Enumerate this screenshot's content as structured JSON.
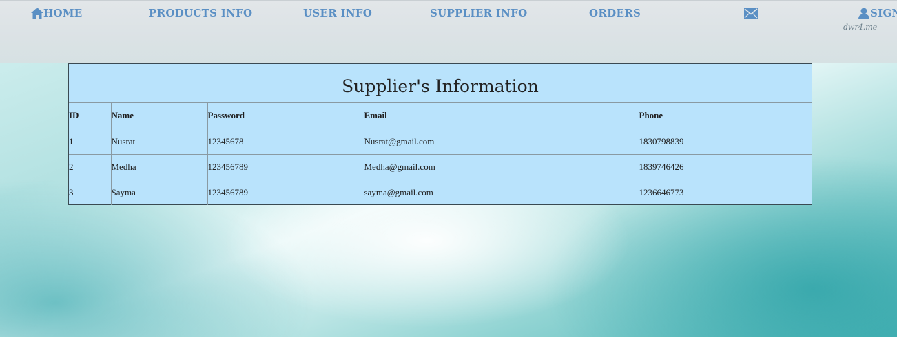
{
  "nav": {
    "home": "HOME",
    "products": "PRODUCTS INFO",
    "users": "USER INFO",
    "suppliers": "SUPPLIER INFO",
    "orders": "ORDERS",
    "sign": "SIGN",
    "watermark": "dwr4.me",
    "icons": {
      "home": "home-icon",
      "mail": "mail-icon",
      "user": "user-icon"
    }
  },
  "table": {
    "title": "Supplier's Information",
    "headers": [
      "ID",
      "Name",
      "Password",
      "Email",
      "Phone"
    ],
    "rows": [
      [
        "1",
        "Nusrat",
        "12345678",
        "Nusrat@gmail.com",
        "1830798839"
      ],
      [
        "2",
        "Medha",
        "123456789",
        "Medha@gmail.com",
        "1839746426"
      ],
      [
        "3",
        "Sayma",
        "123456789",
        "sayma@gmail.com",
        "1236646773"
      ]
    ]
  },
  "colors": {
    "nav_text": "#5a8fc4",
    "panel_bg": "#b9e3fc"
  }
}
